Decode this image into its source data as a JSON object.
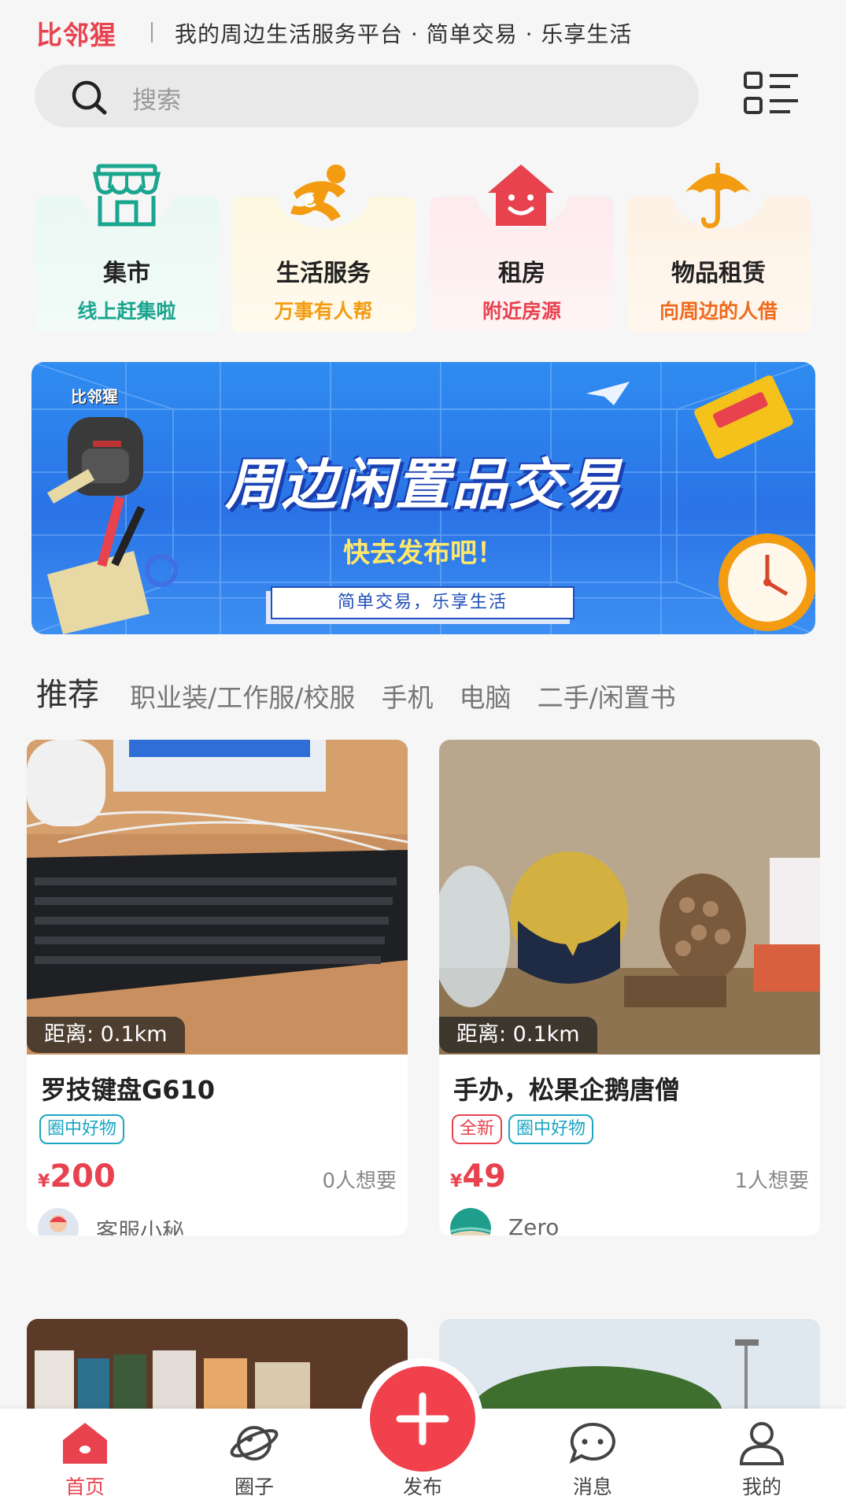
{
  "header": {
    "brand": "比邻猩",
    "slogan": "我的周边生活服务平台 · 简单交易 · 乐享生活"
  },
  "search": {
    "placeholder": "搜索"
  },
  "categories": [
    {
      "title": "集市",
      "subtitle": "线上赶集啦",
      "color": "#1aa58f",
      "icon": "storefront-icon"
    },
    {
      "title": "生活服务",
      "subtitle": "万事有人帮",
      "color": "#f39c12",
      "icon": "running-person-icon"
    },
    {
      "title": "租房",
      "subtitle": "附近房源",
      "color": "#e8424f",
      "icon": "smiling-house-icon"
    },
    {
      "title": "物品租赁",
      "subtitle": "向周边的人借",
      "color": "#f06a1e",
      "icon": "umbrella-icon"
    }
  ],
  "banner": {
    "logo": "比邻猩",
    "title": "周边闲置品交易",
    "subtitle": "快去发布吧！",
    "pill": "简单交易，乐享生活"
  },
  "tabs": [
    {
      "label": "推荐",
      "active": true
    },
    {
      "label": "职业装/工作服/校服"
    },
    {
      "label": "手机"
    },
    {
      "label": "电脑"
    },
    {
      "label": "二手/闲置书"
    }
  ],
  "products": [
    {
      "distance": "距离: 0.1km",
      "title": "罗技键盘G610",
      "tags": [
        "圈中好物"
      ],
      "currency": "¥",
      "price": "200",
      "wants": "0人想要",
      "seller": "客服小秘"
    },
    {
      "distance": "距离: 0.1km",
      "title": "手办，松果企鹅唐僧",
      "tags": [
        "全新",
        "圈中好物"
      ],
      "currency": "¥",
      "price": "49",
      "wants": "1人想要",
      "seller": "Zero"
    }
  ],
  "bottom_nav": [
    {
      "label": "首页",
      "icon": "home-icon",
      "active": true
    },
    {
      "label": "圈子",
      "icon": "planet-icon"
    },
    {
      "label": "发布",
      "icon": "plus-icon"
    },
    {
      "label": "消息",
      "icon": "chat-bubble-icon"
    },
    {
      "label": "我的",
      "icon": "person-icon"
    }
  ],
  "colors": {
    "accent": "#e8424f",
    "tag_blue": "#1aa6c2",
    "banner_blue": "#2a73e6"
  }
}
